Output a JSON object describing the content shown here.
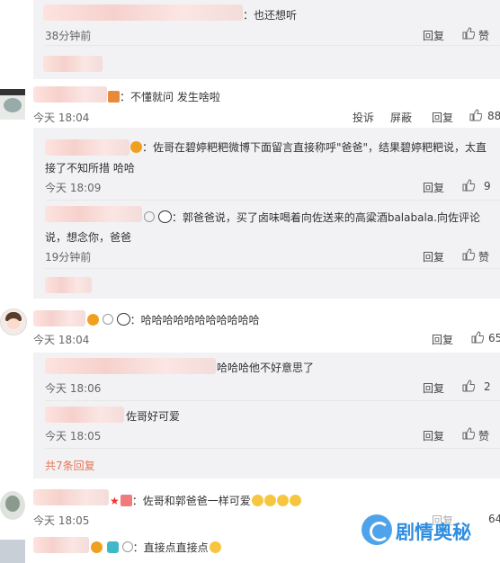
{
  "comments": {
    "c0": {
      "text": "：也还想听",
      "time": "38分钟前",
      "reply": "回复",
      "like": "赞"
    },
    "c1": {
      "text": "：不懂就问 发生啥啦",
      "time": "今天 18:04",
      "report": "投诉",
      "block": "屏蔽",
      "reply": "回复",
      "likes": "88"
    },
    "c1r1": {
      "text1": "：佐哥在碧婷粑粑微博下面留言直接称呼\"爸爸\"，结果碧婷粑粑说，太直",
      "text2": "接了不知所措 哈哈",
      "time": "今天 18:09",
      "reply": "回复",
      "likes": "9"
    },
    "c1r2": {
      "text1": "：郭爸爸说，买了卤味喝着向佐送来的高粱酒balabala.向佐评论",
      "text2": "说，想念你，爸爸",
      "time": "19分钟前",
      "reply": "回复",
      "like": "赞"
    },
    "c2": {
      "text": "：哈哈哈哈哈哈哈哈哈哈哈",
      "time": "今天 18:04",
      "reply": "回复",
      "likes": "65"
    },
    "c2r1": {
      "text": "哈哈哈他不好意思了",
      "time": "今天 18:06",
      "reply": "回复",
      "likes": "2"
    },
    "c2r2": {
      "text": "佐哥好可爱",
      "time": "今天 18:05",
      "reply": "回复",
      "like": "赞"
    },
    "c2more": "共7条回复",
    "c3": {
      "text": "：佐哥和郭爸爸一样可爱",
      "time": "今天 18:05",
      "reply": "回复",
      "likes": "64"
    },
    "c4": {
      "text": "：直接点直接点"
    }
  },
  "watermark": "剧情奥秘",
  "colors": {
    "link": "#eb7350",
    "reply_bg": "#f2f2f5",
    "watermark_blue": "#3d9ae8"
  }
}
